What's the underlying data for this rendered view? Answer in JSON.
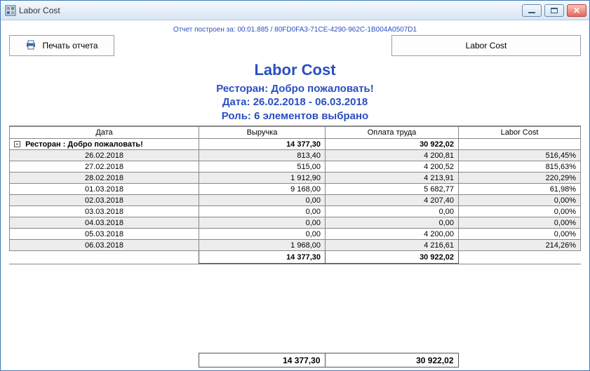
{
  "window": {
    "title": "Labor Cost"
  },
  "meta": "Отчет построен за: 00:01.885 / 80FD0FA3-71CE-4290-962C-1B004A0507D1",
  "toolbar": {
    "print_label": "Печать отчета",
    "right_label": "Labor Cost"
  },
  "header": {
    "title": "Labor Cost",
    "restaurant": "Ресторан: Добро пожаловать!",
    "date_range": "Дата: 26.02.2018 - 06.03.2018",
    "role": "Роль: 6 элементов выбрано"
  },
  "columns": {
    "date": "Дата",
    "revenue": "Выручка",
    "labor_pay": "Оплата труда",
    "labor_cost": "Labor Cost"
  },
  "group": {
    "label": "Ресторан : Добро пожаловать!",
    "revenue": "14 377,30",
    "labor_pay": "30 922,02",
    "labor_cost": ""
  },
  "rows": [
    {
      "date": "26.02.2018",
      "revenue": "813,40",
      "labor_pay": "4 200,81",
      "labor_cost": "516,45%"
    },
    {
      "date": "27.02.2018",
      "revenue": "515,00",
      "labor_pay": "4 200,52",
      "labor_cost": "815,63%"
    },
    {
      "date": "28.02.2018",
      "revenue": "1 912,90",
      "labor_pay": "4 213,91",
      "labor_cost": "220,29%"
    },
    {
      "date": "01.03.2018",
      "revenue": "9 168,00",
      "labor_pay": "5 682,77",
      "labor_cost": "61,98%"
    },
    {
      "date": "02.03.2018",
      "revenue": "0,00",
      "labor_pay": "4 207,40",
      "labor_cost": "0,00%"
    },
    {
      "date": "03.03.2018",
      "revenue": "0,00",
      "labor_pay": "0,00",
      "labor_cost": "0,00%"
    },
    {
      "date": "04.03.2018",
      "revenue": "0,00",
      "labor_pay": "0,00",
      "labor_cost": "0,00%"
    },
    {
      "date": "05.03.2018",
      "revenue": "0,00",
      "labor_pay": "4 200,00",
      "labor_cost": "0,00%"
    },
    {
      "date": "06.03.2018",
      "revenue": "1 968,00",
      "labor_pay": "4 216,61",
      "labor_cost": "214,26%"
    }
  ],
  "subtotal": {
    "revenue": "14 377,30",
    "labor_pay": "30 922,02"
  },
  "grand": {
    "revenue": "14 377,30",
    "labor_pay": "30 922,02"
  }
}
